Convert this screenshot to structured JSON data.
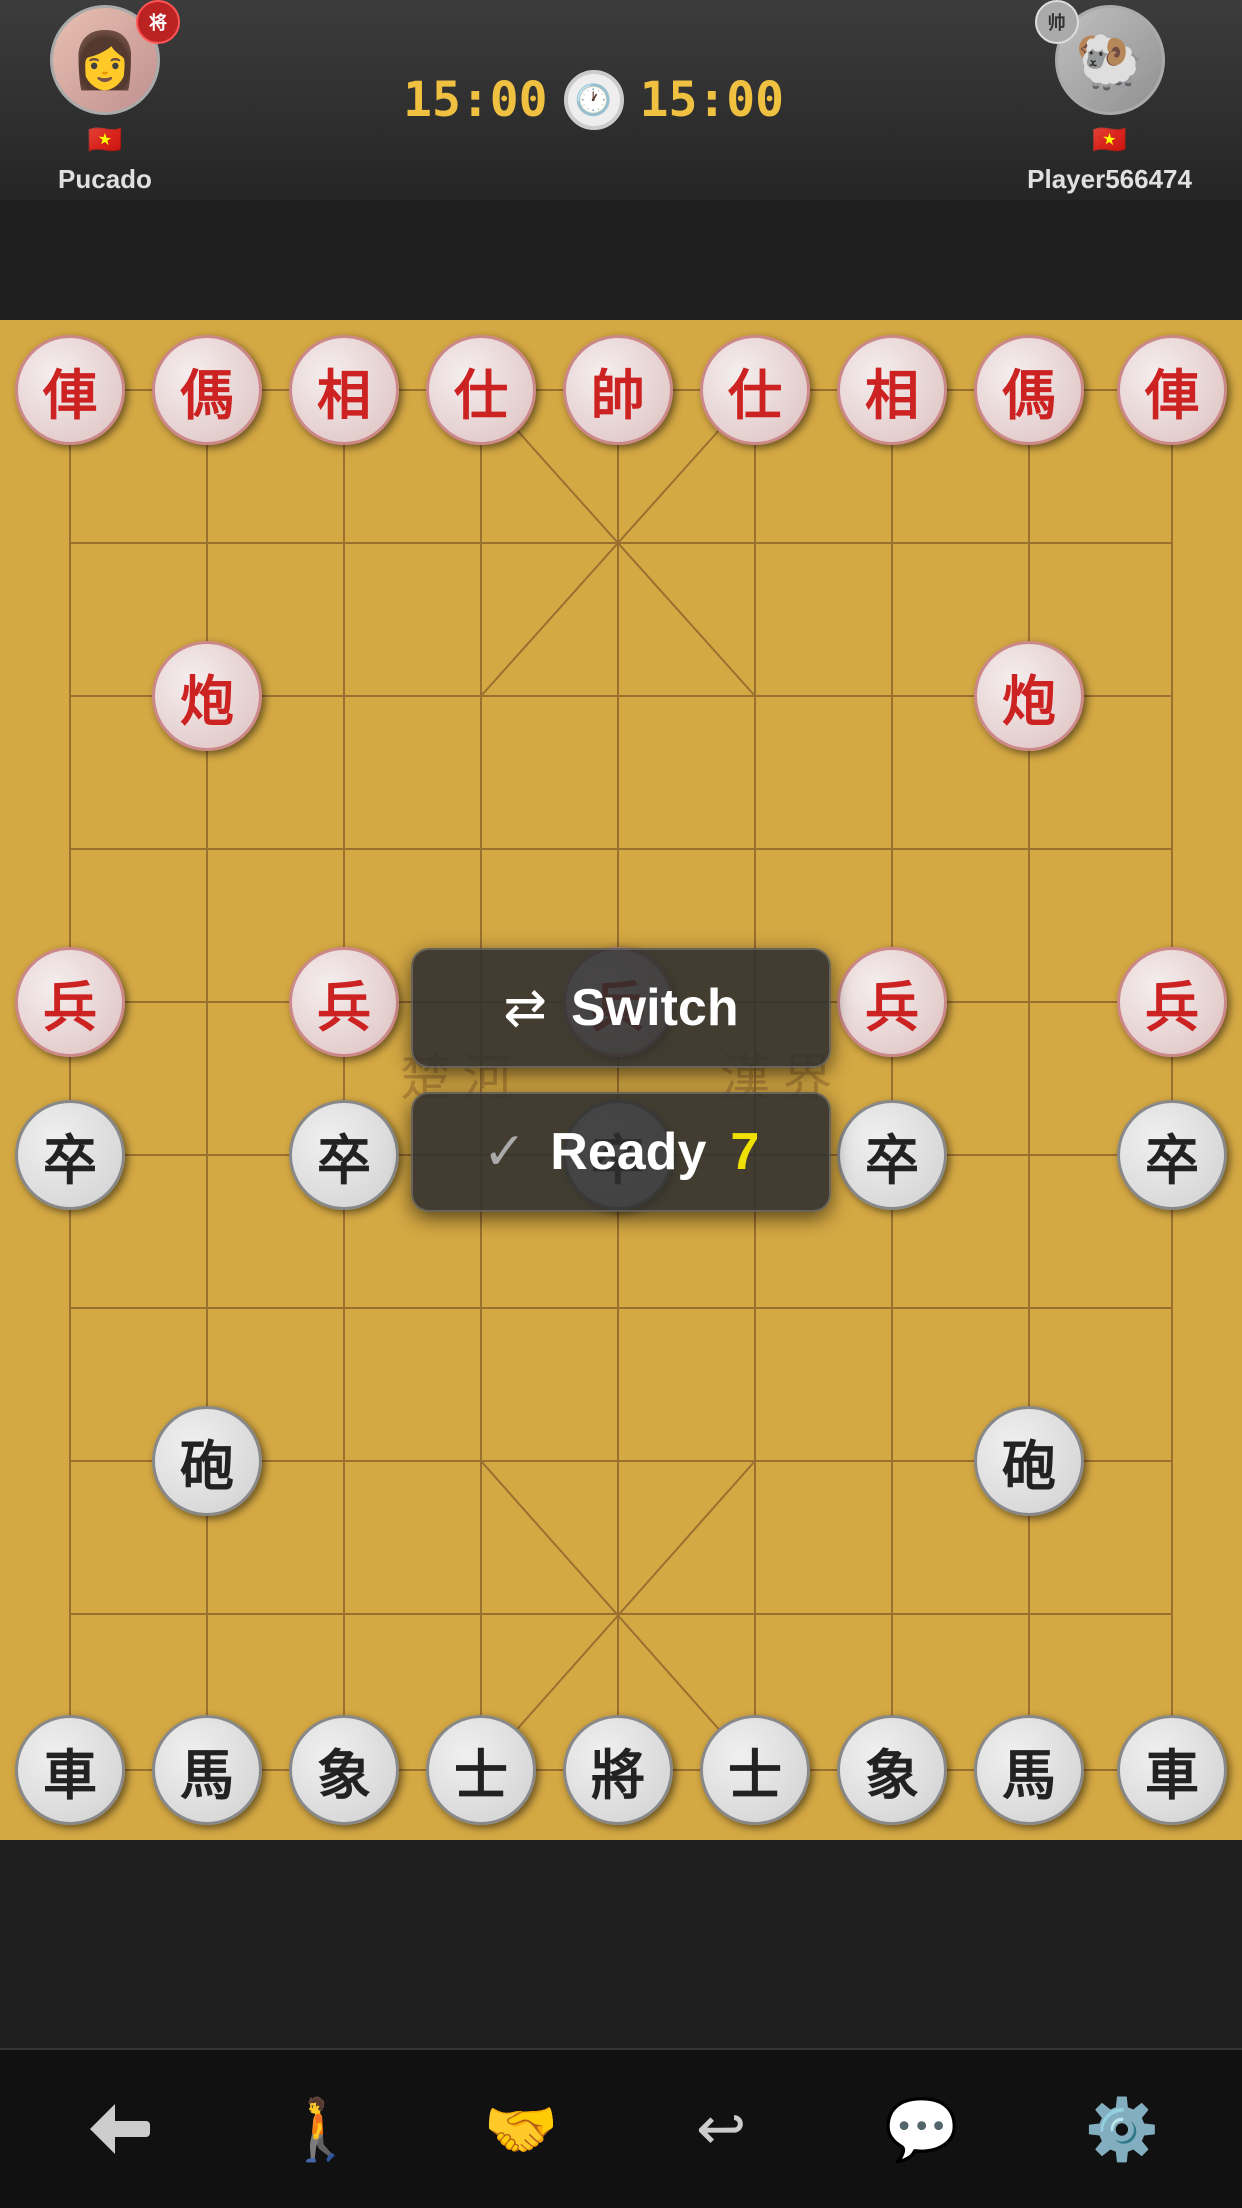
{
  "header": {
    "player_left": {
      "name": "Pucado",
      "badge": "将",
      "flag": "🇻🇳",
      "avatar_symbol": "👩"
    },
    "player_right": {
      "name": "Player566474",
      "badge": "帅",
      "flag": "🇻🇳",
      "avatar_symbol": "🐏"
    },
    "timer_left": "15:00",
    "timer_right": "15:00"
  },
  "board": {
    "cols": 9,
    "rows": 10,
    "red_pieces": [
      {
        "char": "俥",
        "col": 0,
        "row": 0
      },
      {
        "char": "傌",
        "col": 1,
        "row": 0
      },
      {
        "char": "相",
        "col": 2,
        "row": 0
      },
      {
        "char": "仕",
        "col": 3,
        "row": 0
      },
      {
        "char": "帥",
        "col": 4,
        "row": 0
      },
      {
        "char": "仕",
        "col": 5,
        "row": 0
      },
      {
        "char": "相",
        "col": 6,
        "row": 0
      },
      {
        "char": "傌",
        "col": 7,
        "row": 0
      },
      {
        "char": "俥",
        "col": 8,
        "row": 0
      },
      {
        "char": "炮",
        "col": 1,
        "row": 2
      },
      {
        "char": "炮",
        "col": 7,
        "row": 2
      },
      {
        "char": "兵",
        "col": 0,
        "row": 4
      },
      {
        "char": "兵",
        "col": 2,
        "row": 4
      },
      {
        "char": "兵",
        "col": 4,
        "row": 4
      },
      {
        "char": "兵",
        "col": 6,
        "row": 4
      },
      {
        "char": "兵",
        "col": 8,
        "row": 4
      }
    ],
    "black_pieces": [
      {
        "char": "車",
        "col": 0,
        "row": 9
      },
      {
        "char": "馬",
        "col": 1,
        "row": 9
      },
      {
        "char": "象",
        "col": 2,
        "row": 9
      },
      {
        "char": "士",
        "col": 3,
        "row": 9
      },
      {
        "char": "將",
        "col": 4,
        "row": 9
      },
      {
        "char": "士",
        "col": 5,
        "row": 9
      },
      {
        "char": "象",
        "col": 6,
        "row": 9
      },
      {
        "char": "馬",
        "col": 7,
        "row": 9
      },
      {
        "char": "車",
        "col": 8,
        "row": 9
      },
      {
        "char": "砲",
        "col": 1,
        "row": 7
      },
      {
        "char": "砲",
        "col": 7,
        "row": 7
      },
      {
        "char": "卒",
        "col": 0,
        "row": 5
      },
      {
        "char": "卒",
        "col": 2,
        "row": 5
      },
      {
        "char": "卒",
        "col": 4,
        "row": 5
      },
      {
        "char": "卒",
        "col": 6,
        "row": 5
      },
      {
        "char": "卒",
        "col": 8,
        "row": 5
      }
    ]
  },
  "overlay": {
    "switch_label": "Switch",
    "ready_label": "Ready",
    "ready_count": "7"
  },
  "bottom_bar": {
    "buttons": [
      {
        "icon": "←",
        "name": "back"
      },
      {
        "icon": "🚶",
        "name": "walk"
      },
      {
        "icon": "🤝",
        "name": "handshake"
      },
      {
        "icon": "↩",
        "name": "undo"
      },
      {
        "icon": "💬",
        "name": "chat"
      },
      {
        "icon": "⚙",
        "name": "settings"
      }
    ]
  }
}
